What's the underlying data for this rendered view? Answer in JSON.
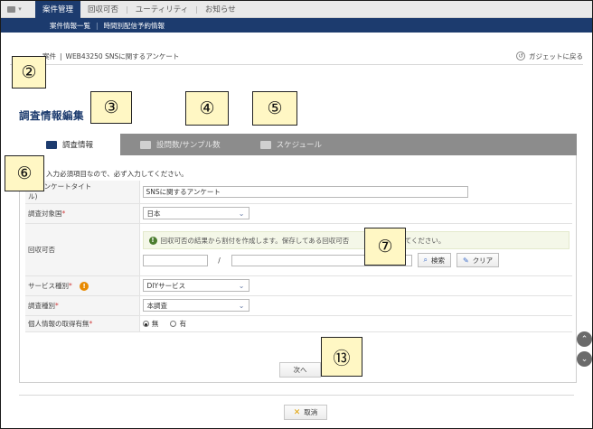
{
  "nav": {
    "tabs": [
      "案件管理",
      "回収可否",
      "ユーティリティ",
      "お知らせ"
    ],
    "active_index": 0,
    "sub_items": [
      "案件情報一覧",
      "時間別配信予約情報"
    ]
  },
  "breadcrumb": {
    "parent": "案件",
    "separator": "|",
    "current": "WEB43250 SNSに関するアンケート"
  },
  "back_link": "ガジェットに戻る",
  "page_title": "調査情報編集",
  "tabs": [
    "調査情報",
    "設問数/サンプル数",
    "スケジュール"
  ],
  "notice": "入力必須項目なので、必ず入力してください。",
  "form": {
    "survey_name_label": "名(アンケートタイト",
    "survey_name_label_2": "ル)",
    "survey_name_value": "SNSに関するアンケート",
    "target_country_label": "調査対象国",
    "target_country_value": "日本",
    "feasibility_label": "回収可否",
    "feasibility_info": "回収可否の結果から割付を作成します。保存してある回収可否",
    "feasibility_info_tail": "してください。",
    "slash": "/",
    "search_button": "検索",
    "clear_button": "クリア",
    "service_type_label": "サービス種別",
    "service_type_value": "DIYサービス",
    "survey_type_label": "調査種別",
    "survey_type_value": "本調査",
    "personal_info_label": "個人情報の取得有無",
    "radio_none": "無",
    "radio_yes": "有",
    "required_mark": "*"
  },
  "next_button": "次へ",
  "cancel_button": "取消",
  "callouts": [
    "②",
    "③",
    "④",
    "⑤",
    "⑥",
    "⑦",
    "⑬"
  ],
  "colors": {
    "navy": "#1c3b6e",
    "callout_bg": "#fff7c4",
    "required": "#d04040",
    "warn": "#e88a00"
  }
}
